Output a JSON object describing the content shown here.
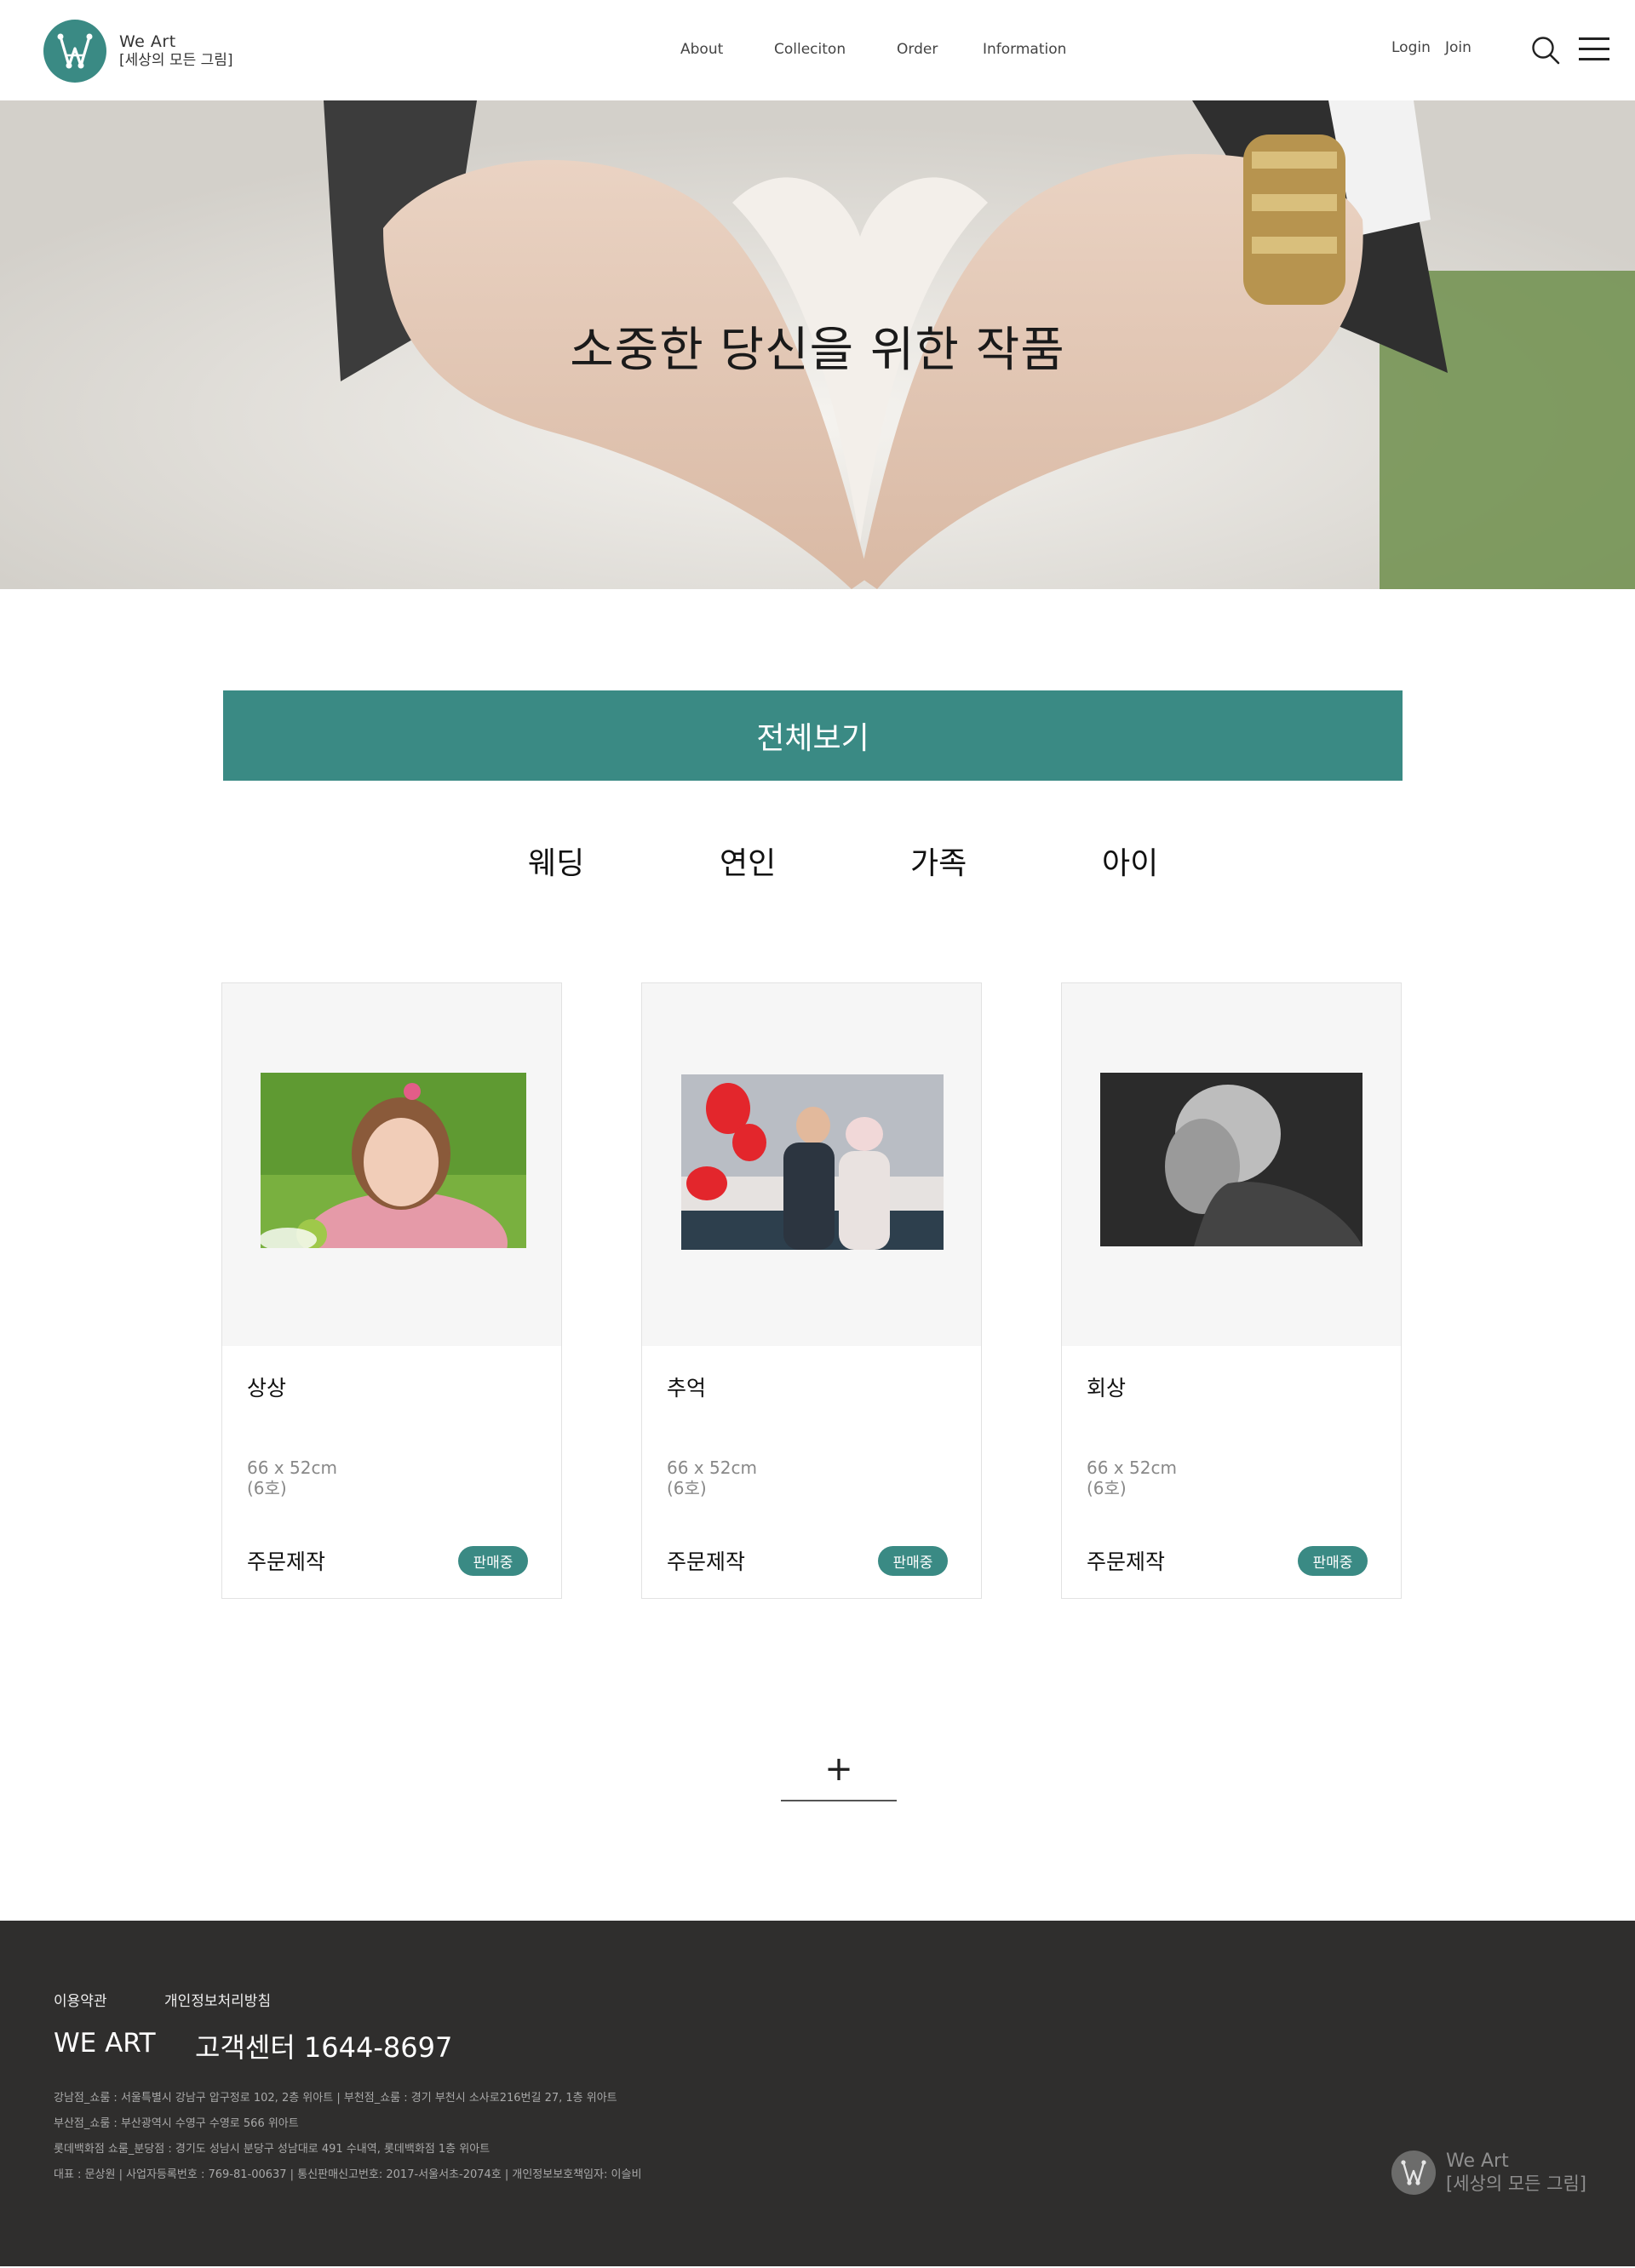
{
  "header": {
    "logo": {
      "line1": "We Art",
      "line2": "[세상의 모든 그림]"
    },
    "nav": [
      "About",
      "Colleciton",
      "Order",
      "Information"
    ],
    "auth": {
      "login": "Login",
      "join": "Join"
    },
    "icons": {
      "search": "search-icon",
      "menu": "hamburger-menu-icon"
    }
  },
  "hero": {
    "title": "소중한 당신을 위한 작품"
  },
  "filter": {
    "all_label": "전체보기",
    "categories": [
      "웨딩",
      "연인",
      "가족",
      "아이"
    ]
  },
  "products": [
    {
      "title": "상상",
      "size": "66 x 52cm",
      "size_note": "(6호)",
      "action": "주문제작",
      "status": "판매중"
    },
    {
      "title": "추억",
      "size": "66 x 52cm",
      "size_note": "(6호)",
      "action": "주문제작",
      "status": "판매중"
    },
    {
      "title": "회상",
      "size": "66 x 52cm",
      "size_note": "(6호)",
      "action": "주문제작",
      "status": "판매중"
    }
  ],
  "more": {
    "label": "+"
  },
  "footer": {
    "links": [
      "이용약관",
      "개인정보처리방침"
    ],
    "brand": "WE ART",
    "customer_center": "고객센터 1644-8697",
    "info": [
      "강남점_쇼룸 : 서울특별시 강남구 압구정로 102, 2층 위아트 | 부천점_쇼룸 : 경기 부천시 소사로216번길 27, 1층 위아트",
      "부산점_쇼룸 : 부산광역시 수영구 수영로 566 위아트",
      "롯데백화점 쇼룸_분당점 : 경기도 성남시 분당구 성남대로 491 수내역, 롯데백화점 1층 위아트",
      "대표 : 문상원 | 사업자등록번호 : 769-81-00637 | 통신판매신고번호: 2017-서울서초-2074호 | 개인정보보호책임자: 이슬비"
    ],
    "logo": {
      "line1": "We Art",
      "line2": "[세상의 모든 그림]"
    }
  },
  "colors": {
    "accent": "#3a8a84",
    "footer_bg": "#2f2e2d"
  }
}
